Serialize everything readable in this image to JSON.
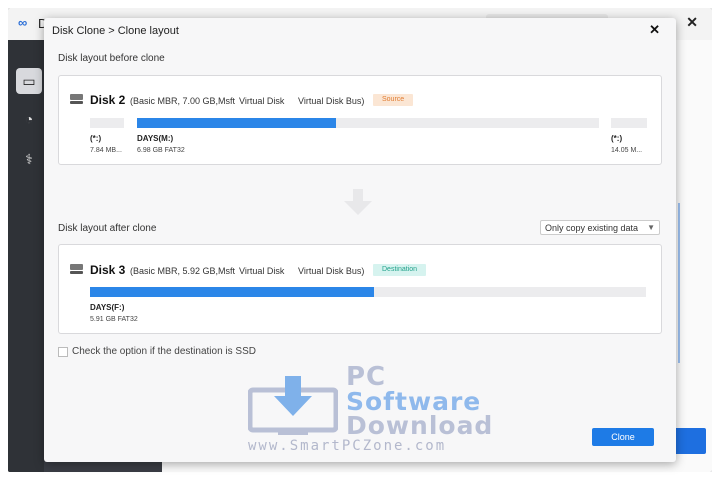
{
  "app": {
    "title_partial": "D",
    "close_glyph": "✕"
  },
  "sidebar": {
    "items": [
      {
        "icon": "drive-icon",
        "glyph": "▭"
      },
      {
        "icon": "pie-chart-icon",
        "glyph": "◔"
      },
      {
        "icon": "stethoscope-icon",
        "glyph": "⚕"
      }
    ]
  },
  "dialog": {
    "title": "Disk Clone > Clone layout",
    "close_glyph": "✕",
    "before": {
      "section_label": "Disk layout before clone",
      "disk_name": "Disk 2",
      "disk_info": "(Basic MBR, 7.00 GB,Msft",
      "disk_type": "Virtual Disk",
      "disk_bus": "Virtual Disk Bus)",
      "badge": "Source",
      "partitions": [
        {
          "label": "(*:)",
          "detail": "7.84 MB...",
          "used_fraction": 0
        },
        {
          "label": "DAYS(M:)",
          "detail": "6.98 GB FAT32",
          "used_fraction": 0.43
        },
        {
          "label": "(*:)",
          "detail": "14.05 M...",
          "used_fraction": 0
        }
      ]
    },
    "after": {
      "section_label": "Disk layout after clone",
      "dropdown_value": "Only copy existing data",
      "dropdown_caret": "▼",
      "disk_name": "Disk 3",
      "disk_info": "(Basic MBR, 5.92 GB,Msft",
      "disk_type": "Virtual Disk",
      "disk_bus": "Virtual Disk Bus)",
      "badge": "Destination",
      "partitions": [
        {
          "label": "DAYS(F:)",
          "detail": "5.91 GB FAT32",
          "used_fraction": 0.51
        }
      ]
    },
    "ssd_option_label": "Check the option if the destination is SSD",
    "clone_button": "Clone"
  },
  "watermark": {
    "line1": "PC",
    "line2": "Software",
    "line3": "Download",
    "url": "www.SmartPCZone.com"
  },
  "colors": {
    "accent": "#1e7be6",
    "bar_fill": "#2b86e8",
    "source_badge": "#e07c32",
    "destination_badge": "#22a28b"
  }
}
